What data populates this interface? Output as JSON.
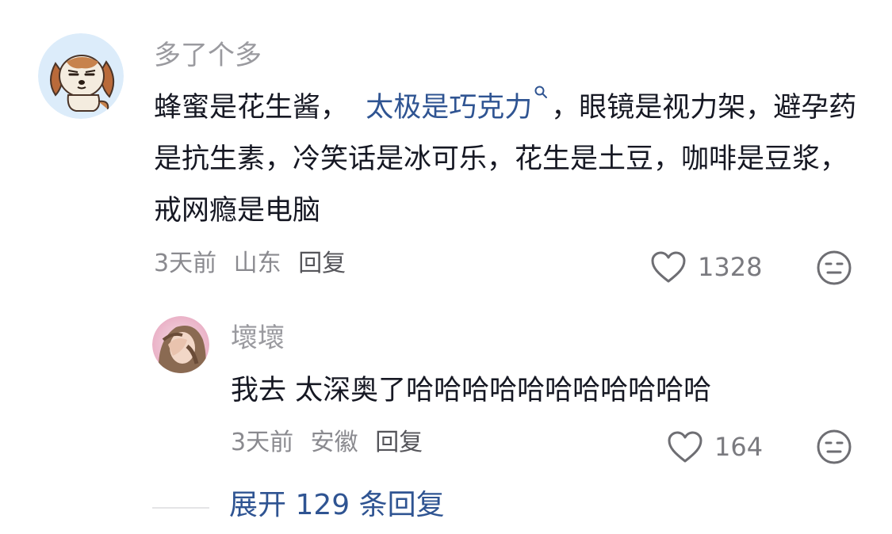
{
  "comment": {
    "username": "多了个多",
    "text_before_link": "蜂蜜是花生酱，",
    "link_text": "太极是巧克力",
    "link_icon": "search-icon",
    "text_after_link": "，眼镜是视力架，避孕药是抗生素，冷笑话是冰可乐，花生是土豆，咖啡是豆浆，戒网瘾是电脑",
    "time": "3天前",
    "location": "山东",
    "reply_label": "回复",
    "like_count": "1328",
    "avatar_icon": "beagle-dog-avatar"
  },
  "reply": {
    "username": "壞壞",
    "text": "我去 太深奥了哈哈哈哈哈哈哈哈哈哈哈",
    "time": "3天前",
    "location": "安徽",
    "reply_label": "回复",
    "like_count": "164",
    "avatar_icon": "girl-photo-avatar"
  },
  "expand": {
    "label": "展开 129 条回复"
  },
  "colors": {
    "link": "#2f5492",
    "username": "#9a9a9f",
    "text": "#161823",
    "meta": "#8a8a8f"
  }
}
